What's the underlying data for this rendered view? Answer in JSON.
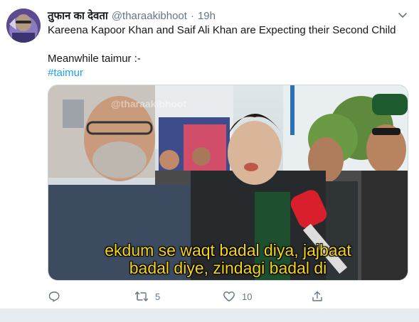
{
  "tweet": {
    "display_name": "तुफान का देवता",
    "handle": "@tharaakibhoot",
    "separator": "·",
    "time": "19h",
    "text_line1": "Kareena Kapoor Khan and Saif Ali Khan are Expecting their Second Child",
    "text_line2": "Meanwhile taimur :-",
    "hashtag": "#taimur"
  },
  "media": {
    "watermark": "@tharaakibhoot",
    "caption_line1": "ekdum se waqt badal diya, jajbaat",
    "caption_line2": "badal diye, zindagi badal di"
  },
  "actions": {
    "reply_count": "",
    "retweet_count": "5",
    "like_count": "10"
  },
  "icons": {
    "more": "chevron-down-icon",
    "reply": "reply-icon",
    "retweet": "retweet-icon",
    "like": "heart-icon",
    "share": "share-icon"
  },
  "colors": {
    "link": "#1da1f2",
    "secondary_text": "#657786",
    "caption": "#f7d511"
  }
}
